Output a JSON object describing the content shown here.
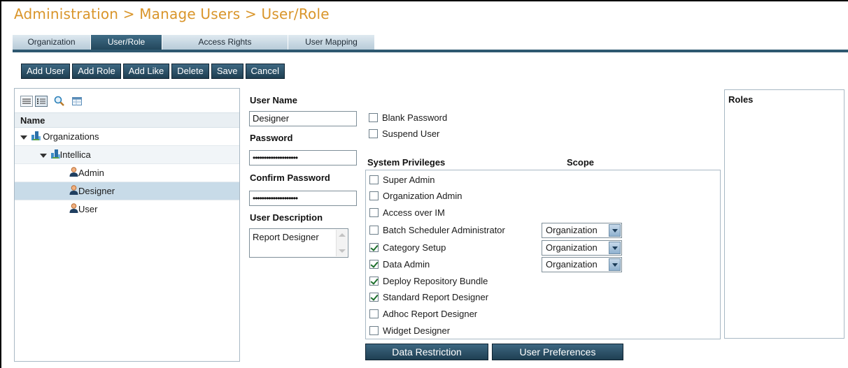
{
  "header": {
    "breadcrumb": "Administration > Manage Users > User/Role"
  },
  "tabs": [
    {
      "label": "Organization",
      "active": false
    },
    {
      "label": "User/Role",
      "active": true
    },
    {
      "label": "Access Rights",
      "active": false
    },
    {
      "label": "User Mapping",
      "active": false
    }
  ],
  "toolbar": {
    "add_user": "Add User",
    "add_role": "Add Role",
    "add_like": "Add Like",
    "delete": "Delete",
    "save": "Save",
    "cancel": "Cancel"
  },
  "tree": {
    "column_header": "Name",
    "nodes": [
      {
        "label": "Organizations",
        "icon": "organization-icon",
        "expanded": true
      },
      {
        "label": "Intellica",
        "icon": "organization-icon",
        "expanded": true
      },
      {
        "label": "Admin",
        "icon": "user-icon"
      },
      {
        "label": "Designer",
        "icon": "user-icon",
        "selected": true
      },
      {
        "label": "User",
        "icon": "user-icon"
      }
    ]
  },
  "form": {
    "user_name_label": "User Name",
    "user_name_value": "Designer",
    "password_label": "Password",
    "password_value": "••••••••••••••••••••",
    "confirm_password_label": "Confirm Password",
    "confirm_password_value": "••••••••••••••••••••",
    "user_description_label": "User Description",
    "user_description_value": "Report Designer",
    "blank_password_label": "Blank Password",
    "suspend_user_label": "Suspend User"
  },
  "privileges": {
    "header": "System Privileges",
    "scope_header": "Scope",
    "items": [
      {
        "label": "Super Admin",
        "checked": false
      },
      {
        "label": "Organization Admin",
        "checked": false
      },
      {
        "label": "Access over IM",
        "checked": false
      },
      {
        "label": "Batch Scheduler Administrator",
        "checked": false,
        "scope": "Organization"
      },
      {
        "label": "Category Setup",
        "checked": true,
        "scope": "Organization"
      },
      {
        "label": "Data Admin",
        "checked": true,
        "scope": "Organization"
      },
      {
        "label": "Deploy Repository Bundle",
        "checked": true
      },
      {
        "label": "Standard Report Designer",
        "checked": true
      },
      {
        "label": "Adhoc Report Designer",
        "checked": false
      },
      {
        "label": "Widget Designer",
        "checked": false
      }
    ]
  },
  "roles": {
    "header": "Roles"
  },
  "buttons": {
    "data_restriction": "Data Restriction",
    "user_preferences": "User Preferences"
  },
  "colors": {
    "title": "#d9952a",
    "tab_active": "#2e5870",
    "button": "#2c5268",
    "checkmark": "#1d6f2c",
    "selected_row": "#c8dbe8"
  }
}
